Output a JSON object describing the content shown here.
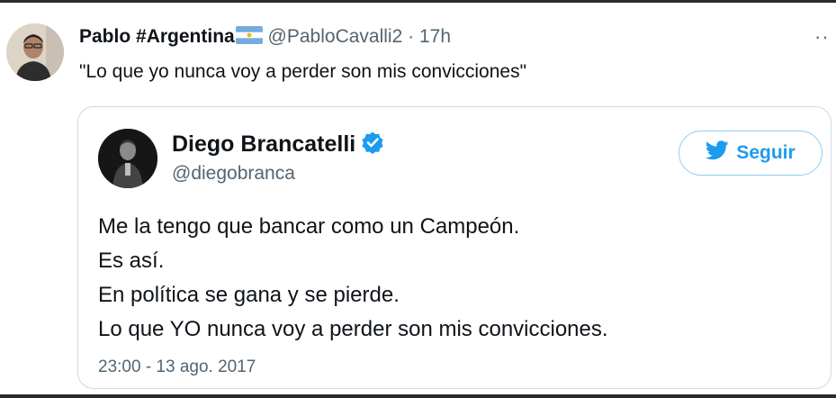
{
  "tweet": {
    "author_name": "Pablo #Argentina",
    "flag_icon": "argentina-flag-icon",
    "handle": "@PabloCavalli2",
    "separator": "·",
    "time": "17h",
    "more_icon": "more-icon",
    "more_label": "··",
    "text": "\"Lo que yo nunca voy a perder son mis convicciones\""
  },
  "quoted": {
    "name": "Diego Brancatelli",
    "verified_icon": "verified-badge-icon",
    "handle": "@diegobranca",
    "follow_icon": "twitter-bird-icon",
    "follow_label": "Seguir",
    "lines": [
      "Me la tengo que bancar como un Campeón.",
      "Es así.",
      "En política se gana y se pierde.",
      "Lo que YO nunca voy a perder son mis convicciones."
    ],
    "date": "23:00 - 13 ago. 2017"
  },
  "colors": {
    "accent": "#1d9bf0",
    "secondary_text": "#536471",
    "border": "#cfd9de",
    "flag_blue": "#74acdf",
    "sun": "#f6b40e"
  }
}
